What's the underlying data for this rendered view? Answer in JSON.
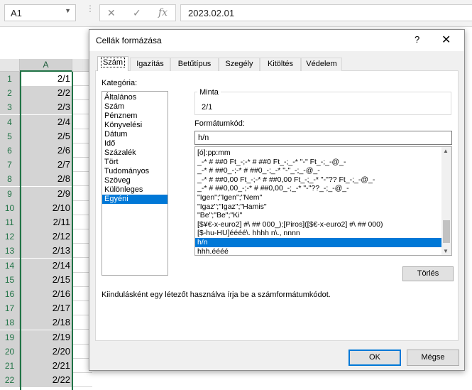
{
  "excel": {
    "name_box": "A1",
    "formula_value": "2023.02.01",
    "column_header": "A",
    "rows": [
      {
        "num": "1",
        "value": "2/1"
      },
      {
        "num": "2",
        "value": "2/2"
      },
      {
        "num": "3",
        "value": "2/3"
      },
      {
        "num": "4",
        "value": "2/4"
      },
      {
        "num": "5",
        "value": "2/5"
      },
      {
        "num": "6",
        "value": "2/6"
      },
      {
        "num": "7",
        "value": "2/7"
      },
      {
        "num": "8",
        "value": "2/8"
      },
      {
        "num": "9",
        "value": "2/9"
      },
      {
        "num": "10",
        "value": "2/10"
      },
      {
        "num": "11",
        "value": "2/11"
      },
      {
        "num": "12",
        "value": "2/12"
      },
      {
        "num": "13",
        "value": "2/13"
      },
      {
        "num": "14",
        "value": "2/14"
      },
      {
        "num": "15",
        "value": "2/15"
      },
      {
        "num": "16",
        "value": "2/16"
      },
      {
        "num": "17",
        "value": "2/17"
      },
      {
        "num": "18",
        "value": "2/18"
      },
      {
        "num": "19",
        "value": "2/19"
      },
      {
        "num": "20",
        "value": "2/20"
      },
      {
        "num": "21",
        "value": "2/21"
      },
      {
        "num": "22",
        "value": "2/22"
      }
    ]
  },
  "dialog": {
    "title": "Cellák formázása",
    "help": "?",
    "close": "✕",
    "tabs": [
      "Szám",
      "Igazítás",
      "Betűtípus",
      "Szegély",
      "Kitöltés",
      "Védelem"
    ],
    "category_label": "Kategória:",
    "categories": [
      "Általános",
      "Szám",
      "Pénznem",
      "Könyvelési",
      "Dátum",
      "Idő",
      "Százalék",
      "Tört",
      "Tudományos",
      "Szöveg",
      "Különleges",
      "Egyéni"
    ],
    "selected_category": "Egyéni",
    "sample_label": "Minta",
    "sample_value": "2/1",
    "format_code_label": "Formátumkód:",
    "format_code_value": "h/n",
    "format_codes": [
      "[ó]:pp:mm",
      "_-* # ##0 Ft_-;-* # ##0 Ft_-;_-* \"-\" Ft_-;_-@_-",
      "_-* # ##0_-;-* # ##0_-;_-* \"-\"_-;_-@_-",
      "_-* # ##0,00 Ft_-;-* # ##0,00 Ft_-;_-* \"-\"?? Ft_-;_-@_-",
      "_-* # ##0,00_-;-* # ##0,00_-;_-* \"-\"??_-;_-@_-",
      "\"Igen\";\"Igen\";\"Nem\"",
      "\"Igaz\";\"Igaz\";\"Hamis\"",
      "\"Be\";\"Be\";\"Ki\"",
      "[$¥€-x-euro2] #\\ ## 000_);[Piros]([$€-x-euro2] #\\ ## 000)",
      "[$-hu-HU]éééé\\. hhhh n\\., nnnn",
      "h/n",
      "hhh.éééé"
    ],
    "selected_format": "h/n",
    "delete_button": "Törlés",
    "hint": "Kiindulásként egy létezőt használva írja be a számformátumkódot.",
    "ok_button": "OK",
    "cancel_button": "Mégse"
  },
  "colors": {
    "accent": "#0078d7",
    "excel_green": "#217346"
  }
}
